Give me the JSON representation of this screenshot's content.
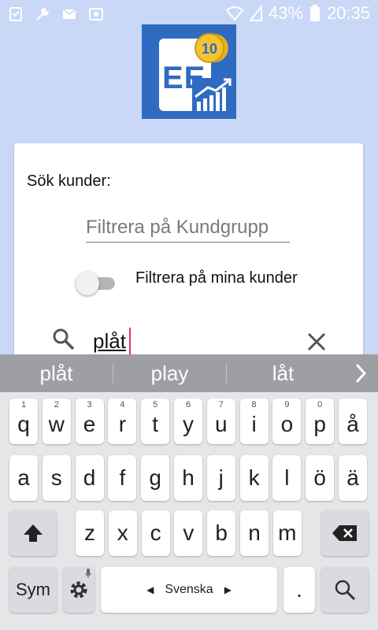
{
  "status": {
    "icons": [
      "checklist-icon",
      "wrench-icon",
      "mail-icon",
      "camera-icon"
    ],
    "battery_percent": "43%",
    "time": "20:35"
  },
  "logo": {
    "text": "EE",
    "coin_text": "10",
    "bg_color": "#2f6cc1"
  },
  "card": {
    "title": "Sök kunder:",
    "group_placeholder": "Filtrera på Kundgrupp",
    "toggle_label": "Filtrera på mina kunder",
    "toggle_on": false,
    "search_value": "plåt"
  },
  "suggestions": [
    "plåt",
    "play",
    "låt"
  ],
  "keyboard": {
    "row1": [
      {
        "k": "q",
        "h": "1"
      },
      {
        "k": "w",
        "h": "2"
      },
      {
        "k": "e",
        "h": "3"
      },
      {
        "k": "r",
        "h": "4"
      },
      {
        "k": "t",
        "h": "5"
      },
      {
        "k": "y",
        "h": "6"
      },
      {
        "k": "u",
        "h": "7"
      },
      {
        "k": "i",
        "h": "8"
      },
      {
        "k": "o",
        "h": "9"
      },
      {
        "k": "p",
        "h": "0"
      },
      {
        "k": "å",
        "h": ""
      }
    ],
    "row2": [
      "a",
      "s",
      "d",
      "f",
      "g",
      "h",
      "j",
      "k",
      "l",
      "ö",
      "ä"
    ],
    "row3": [
      "z",
      "x",
      "c",
      "v",
      "b",
      "n",
      "m"
    ],
    "sym_label": "Sym",
    "space_label": "Svenska",
    "period_label": "."
  }
}
